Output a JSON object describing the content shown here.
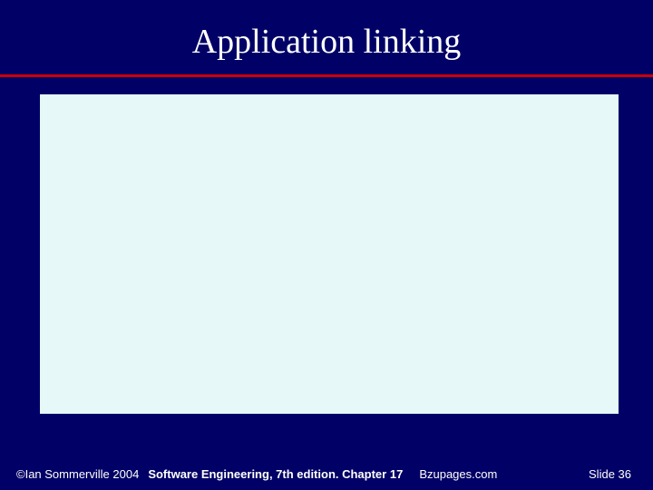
{
  "slide": {
    "title": "Application linking"
  },
  "footer": {
    "copyright": "©Ian Sommerville 2004",
    "book": "Software Engineering, 7th edition. Chapter 17",
    "site": "Bzupages.com",
    "slide_label": "Slide  36"
  }
}
